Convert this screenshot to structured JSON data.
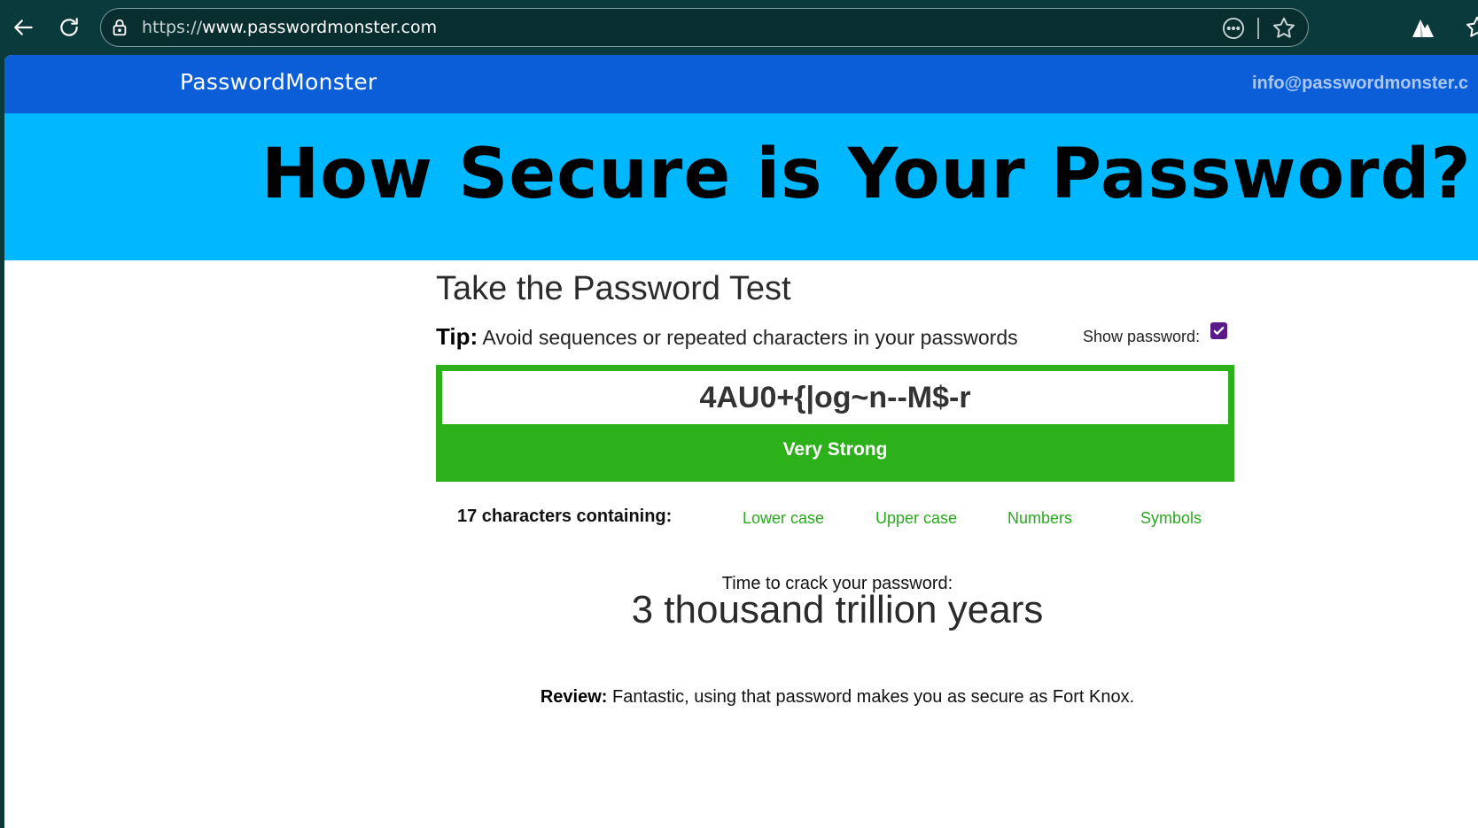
{
  "browser": {
    "url_prefix": "https://",
    "url_host": "www.passwordmonster.com",
    "icons": [
      "back-arrow-icon",
      "reload-icon",
      "lock-icon",
      "more-options-icon",
      "star-icon",
      "extension-icon",
      "favorites-icon"
    ]
  },
  "site": {
    "brand": "PasswordMonster",
    "email": "info@passwordmonster.c",
    "hero_title": "How Secure is Your Password?",
    "colors": {
      "nav": "#0b5ed7",
      "hero": "#00b8ff",
      "strength": "#2db11a",
      "char_type": "#2ba81f"
    }
  },
  "test": {
    "title": "Take the Password Test",
    "tip_label": "Tip:",
    "tip_text": "Avoid sequences or repeated characters in your passwords",
    "show_password_label": "Show password:",
    "show_password_checked": true,
    "password_value": "4AU0+{|og~n--M$-r",
    "strength": "Very Strong",
    "chars_summary": "17 characters containing:",
    "char_types": [
      "Lower case",
      "Upper case",
      "Numbers",
      "Symbols"
    ],
    "crack_label": "Time to crack your password:",
    "crack_value": "3 thousand trillion years",
    "review_label": "Review:",
    "review_text": "Fantastic, using that password makes you as secure as Fort Knox."
  }
}
